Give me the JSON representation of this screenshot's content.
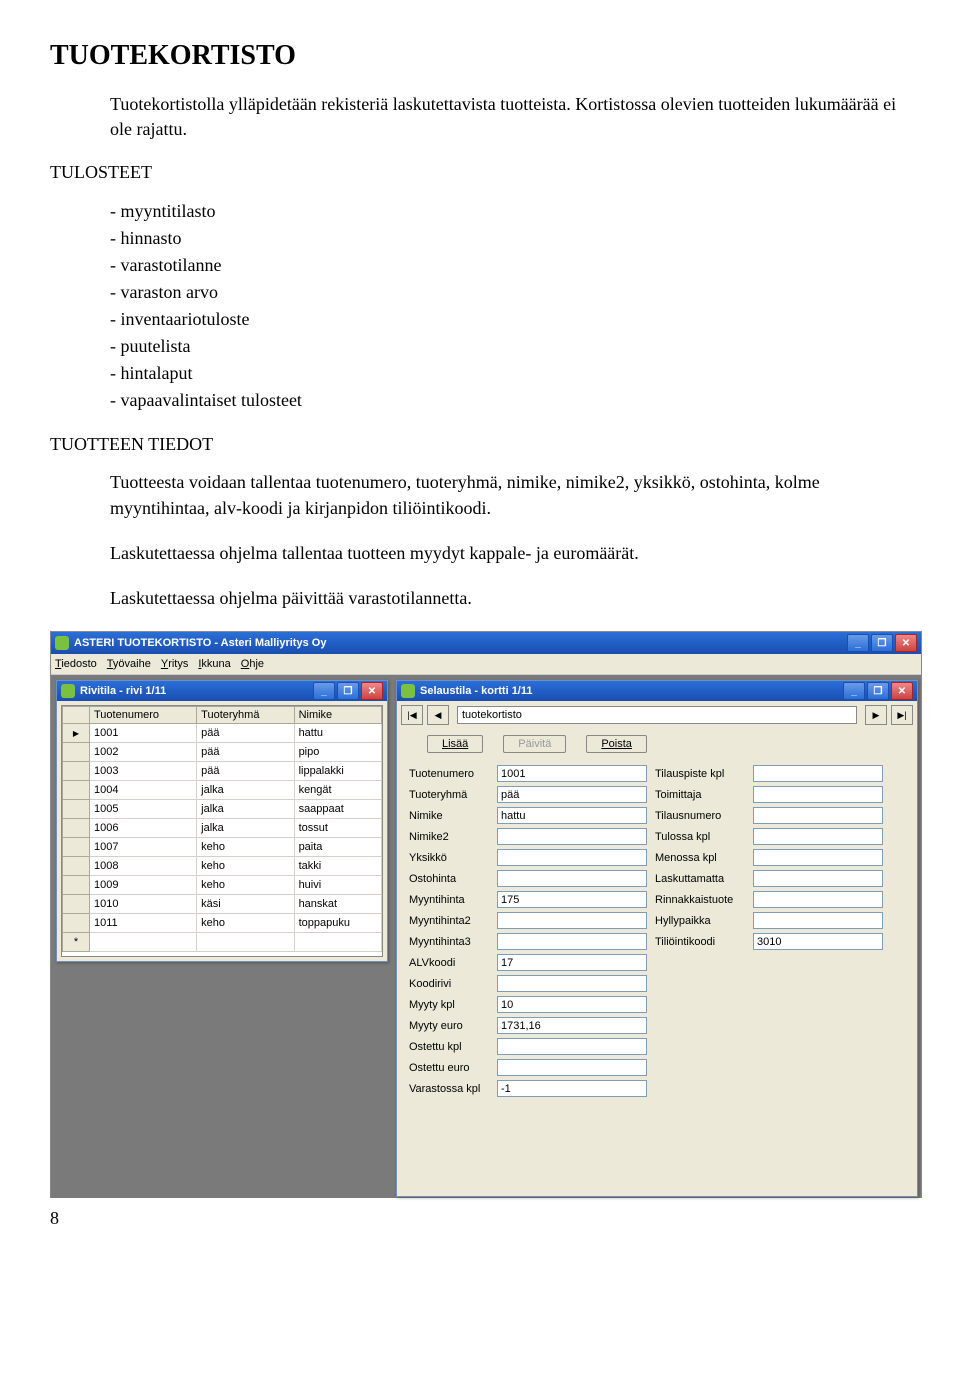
{
  "doc": {
    "h1": "TUOTEKORTISTO",
    "intro": "Tuotekortistolla ylläpidetään rekisteriä laskutettavista tuotteista. Kortistossa olevien tuotteiden lukumäärää ei ole rajattu.",
    "h2a": "TULOSTEET",
    "bullets": [
      "myyntitilasto",
      "hinnasto",
      "varastotilanne",
      "varaston arvo",
      "inventaariotuloste",
      "puutelista",
      "hintalaput",
      "vapaavalintaiset tulosteet"
    ],
    "h2b": "TUOTTEEN TIEDOT",
    "p1": "Tuotteesta voidaan tallentaa tuotenumero, tuoteryhmä, nimike, nimike2, yksikkö, ostohinta, kolme myyntihintaa, alv-koodi ja kirjanpidon tiliöintikoodi.",
    "p2": "Laskutettaessa ohjelma tallentaa tuotteen myydyt kappale- ja euromäärät.",
    "p3": "Laskutettaessa ohjelma päivittää varastotilannetta.",
    "pagenum": "8"
  },
  "app": {
    "title": "ASTERI TUOTEKORTISTO - Asteri Malliyritys Oy",
    "menu": [
      "Tiedosto",
      "Työvaihe",
      "Yritys",
      "Ikkuna",
      "Ohje"
    ]
  },
  "rivitila": {
    "title": "Rivitila - rivi 1/11",
    "cols": [
      "Tuotenumero",
      "Tuoteryhmä",
      "Nimike"
    ],
    "rows": [
      [
        "1001",
        "pää",
        "hattu"
      ],
      [
        "1002",
        "pää",
        "pipo"
      ],
      [
        "1003",
        "pää",
        "lippalakki"
      ],
      [
        "1004",
        "jalka",
        "kengät"
      ],
      [
        "1005",
        "jalka",
        "saappaat"
      ],
      [
        "1006",
        "jalka",
        "tossut"
      ],
      [
        "1007",
        "keho",
        "paita"
      ],
      [
        "1008",
        "keho",
        "takki"
      ],
      [
        "1009",
        "keho",
        "huivi"
      ],
      [
        "1010",
        "käsi",
        "hanskat"
      ],
      [
        "1011",
        "keho",
        "toppapuku"
      ]
    ]
  },
  "selaustila": {
    "title": "Selaustila - kortti 1/11",
    "cardname": "tuotekortisto",
    "buttons": {
      "add": "Lisää",
      "print": "Päivitä",
      "delete": "Poista"
    },
    "leftFields": [
      {
        "label": "Tuotenumero",
        "value": "1001"
      },
      {
        "label": "Tuoteryhmä",
        "value": "pää"
      },
      {
        "label": "Nimike",
        "value": "hattu"
      },
      {
        "label": "Nimike2",
        "value": ""
      },
      {
        "label": "Yksikkö",
        "value": ""
      },
      {
        "label": "Ostohinta",
        "value": ""
      },
      {
        "label": "Myyntihinta",
        "value": "175"
      },
      {
        "label": "Myyntihinta2",
        "value": ""
      },
      {
        "label": "Myyntihinta3",
        "value": ""
      },
      {
        "label": "ALVkoodi",
        "value": "17"
      },
      {
        "label": "Koodirivi",
        "value": ""
      },
      {
        "label": "Myyty kpl",
        "value": "10"
      },
      {
        "label": "Myyty euro",
        "value": "1731,16"
      },
      {
        "label": "Ostettu kpl",
        "value": ""
      },
      {
        "label": "Ostettu euro",
        "value": ""
      },
      {
        "label": "Varastossa kpl",
        "value": "-1"
      }
    ],
    "rightFields": [
      {
        "label": "Tilauspiste kpl",
        "value": ""
      },
      {
        "label": "Toimittaja",
        "value": ""
      },
      {
        "label": "Tilausnumero",
        "value": ""
      },
      {
        "label": "Tulossa kpl",
        "value": ""
      },
      {
        "label": "Menossa kpl",
        "value": ""
      },
      {
        "label": "Laskuttamatta",
        "value": ""
      },
      {
        "label": "Rinnakkaistuote",
        "value": ""
      },
      {
        "label": "Hyllypaikka",
        "value": ""
      },
      {
        "label": "Tiliöintikoodi",
        "value": "3010"
      }
    ]
  }
}
